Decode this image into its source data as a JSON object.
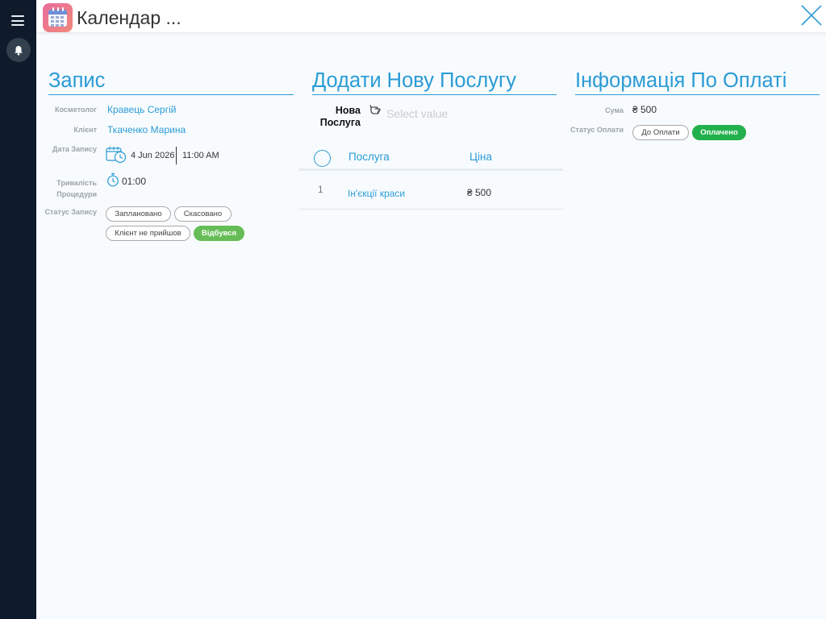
{
  "header": {
    "title": "Календар ...",
    "close_icon": "close-icon",
    "app_icon": "calendar-app-icon"
  },
  "sidebar": {
    "menu_icon": "hamburger-icon",
    "notifications_icon": "bell-icon"
  },
  "appointment": {
    "title": "Запис",
    "cosmetologist_label": "Косметолог",
    "cosmetologist_value": "Кравець Сергій",
    "client_label": "Клієнт",
    "client_value": "Ткаченко Марина",
    "date_label": "Дата Запису",
    "date_value": "4 Jun 2026",
    "time_value": "11:00 AM",
    "duration_label": "Тривалість Процедури",
    "duration_value": "01:00",
    "status_label": "Статус Запису",
    "status_options": [
      "Заплановано",
      "Скасовано",
      "Клієнт не прийшов",
      "Відбувся"
    ],
    "status_selected": "Відбувся"
  },
  "services": {
    "title": "Додати Нову Послугу",
    "new_service_label": "Нова Послуга",
    "select_placeholder": "Select value",
    "columns": [
      "Послуга",
      "Ціна"
    ],
    "rows": [
      {
        "index": "1",
        "service": "Ін'єкції краси",
        "price": "₴ 500"
      }
    ]
  },
  "payment": {
    "title": "Інформація По Оплаті",
    "sum_label": "Сума",
    "sum_value": "₴ 500",
    "status_label": "Статус Оплати",
    "status_options": [
      "До Оплати",
      "Оплачено"
    ],
    "status_selected": "Оплачено"
  },
  "colors": {
    "accent": "#2a9bd6",
    "sidebar_bg": "#0f1a2a",
    "status_done": "#66bd57",
    "paid": "#22b14c"
  }
}
